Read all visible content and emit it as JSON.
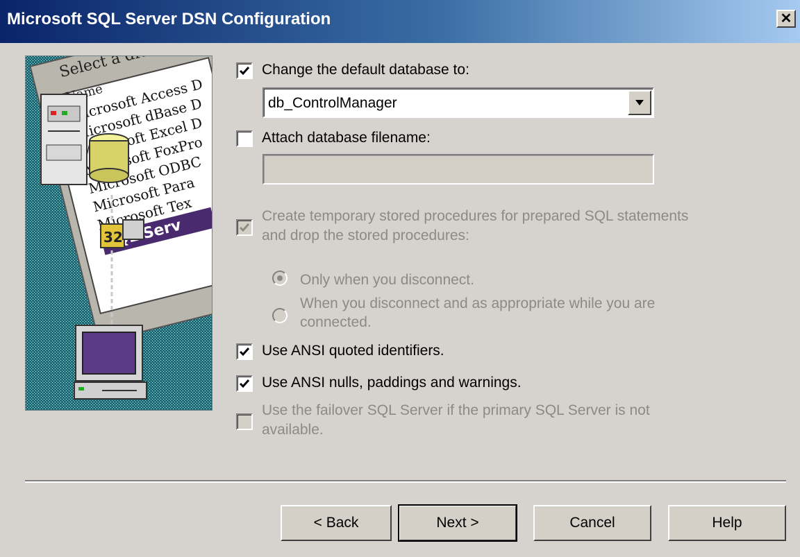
{
  "window": {
    "title": "Microsoft SQL Server DSN Configuration",
    "close_label": "✕"
  },
  "illustration": {
    "header": "Select a driver for",
    "column": "Name",
    "drivers": [
      "Microsoft Access D",
      "Microsoft dBase D",
      "Microsoft Excel D",
      "Microsoft FoxPro",
      "Microsoft ODBC",
      "Microsoft Para",
      "Microsoft Tex",
      "SQL Serv"
    ],
    "badge": "32"
  },
  "options": {
    "change_db": {
      "label": "Change the default database to:",
      "checked": true
    },
    "database": {
      "value": "db_ControlManager"
    },
    "attach_db": {
      "label": "Attach database filename:",
      "checked": false,
      "value": ""
    },
    "temp_procs": {
      "label_line1": "Create temporary stored procedures for prepared SQL statements",
      "label_line2": "and drop the stored procedures:",
      "checked": true,
      "enabled": false
    },
    "radio_disconnect": {
      "label": "Only when you disconnect.",
      "selected": true
    },
    "radio_appropriate": {
      "label_line1": "When you disconnect and as appropriate while you are",
      "label_line2": "connected.",
      "selected": false
    },
    "ansi_quoted": {
      "label": "Use ANSI quoted identifiers.",
      "checked": true
    },
    "ansi_nulls": {
      "label": "Use ANSI nulls, paddings and warnings.",
      "checked": true
    },
    "failover": {
      "label_line1": "Use the failover SQL Server if the primary SQL Server is not",
      "label_line2": "available.",
      "checked": false,
      "enabled": false
    }
  },
  "buttons": {
    "back": "< Back",
    "next": "Next >",
    "cancel": "Cancel",
    "help": "Help"
  }
}
